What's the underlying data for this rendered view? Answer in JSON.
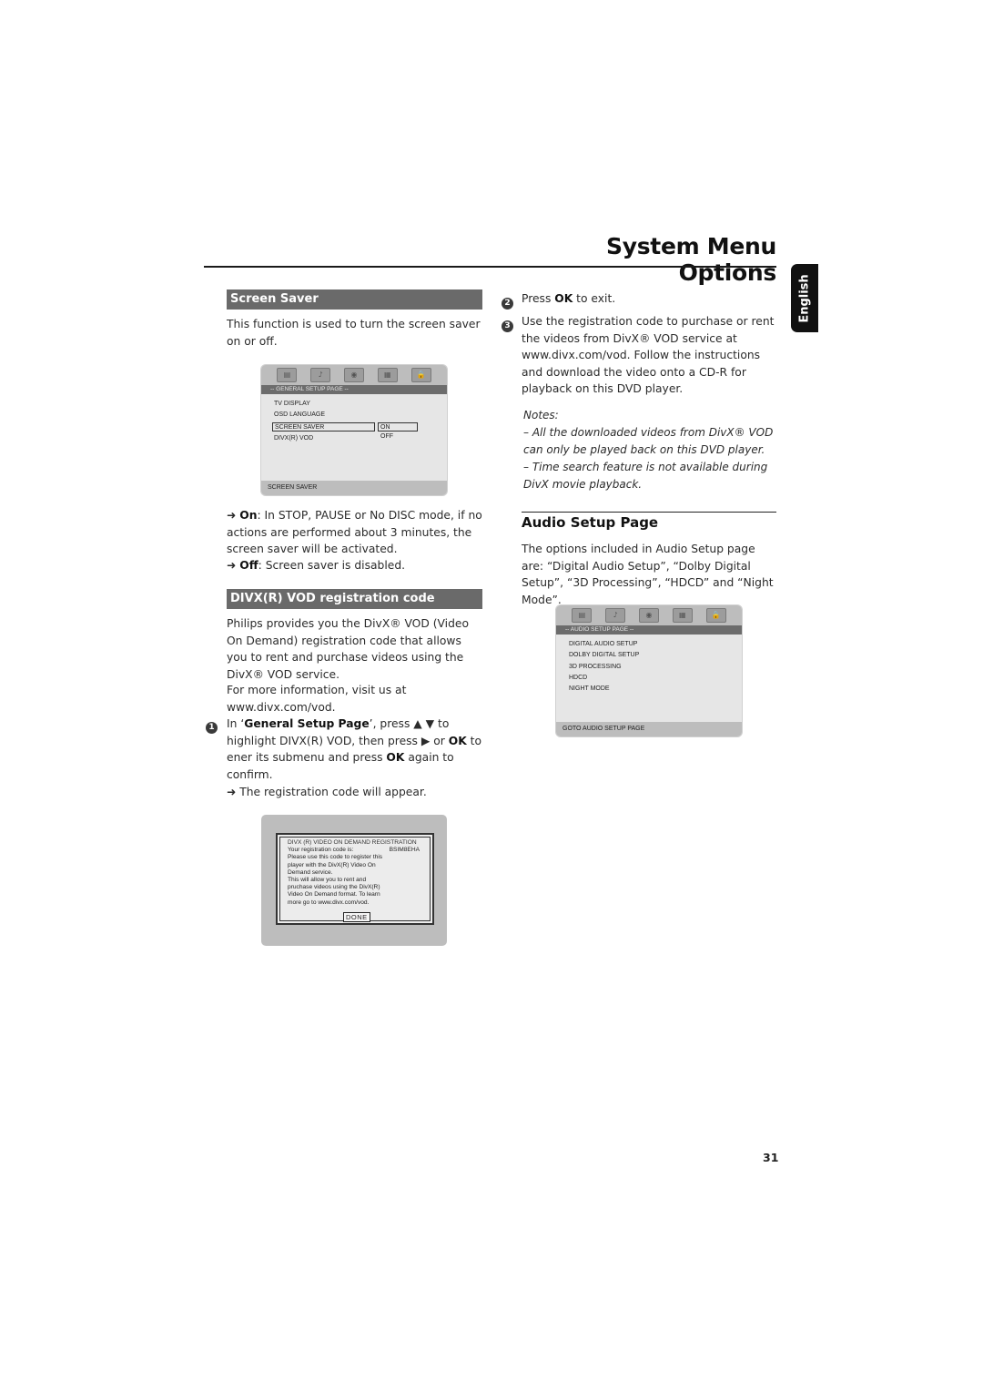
{
  "header": {
    "title": "System Menu Options",
    "language_tab": "English"
  },
  "left_column": {
    "screen_saver": {
      "heading": "Screen Saver",
      "description": "This function is used to turn the screen saver on or off.",
      "osd": {
        "icons": [
          "general-setup-icon",
          "audio-setup-icon",
          "video-setup-icon",
          "preference-icon",
          "password-lock-icon"
        ],
        "page_bar": "-- GENERAL SETUP PAGE --",
        "items": [
          "TV DISPLAY",
          "OSD LANGUAGE",
          "SCREEN SAVER",
          "DIVX(R) VOD"
        ],
        "selected_item": "SCREEN SAVER",
        "options": [
          "ON",
          "OFF"
        ],
        "selected_option": "ON",
        "footer": "SCREEN SAVER"
      },
      "on_label": "On",
      "on_text": ": In STOP, PAUSE or No DISC mode, if no actions are performed about 3 minutes, the screen saver will be activated.",
      "off_label": "Off",
      "off_text": ": Screen saver is disabled."
    },
    "divx": {
      "heading": "DIVX(R) VOD registration code",
      "intro_1": "Philips provides you the DivX® VOD (Video On Demand) registration code that allows you to rent and purchase videos using the DivX® VOD service.",
      "intro_2": "For more information, visit us at www.divx.com/vod.",
      "step1_num": "1",
      "step1_pre": "In ‘",
      "step1_bold": "General Setup Page",
      "step1_mid": "’, press ▲ ▼ to highlight DIVX(R) VOD, then press ▶ or ",
      "step1_ok1": "OK",
      "step1_mid2": " to ener its submenu and press ",
      "step1_ok2": "OK",
      "step1_end": " again to confirm.",
      "step1_result": "The registration code will appear.",
      "dialog": {
        "title": "DIVX (R) VIDEO ON DEMAND REGISTRATION",
        "code_label": "Your registration code is:",
        "code_value": "BSIM8EHA",
        "lines": [
          "Please use this code to register this",
          "player with the DivX(R) Video On",
          "Demand service.",
          "This will allow you to rent and",
          "pruchase videos using the DivX(R)",
          "Video On Demand format. To learn",
          "more go to www.divx.com/vod."
        ],
        "done_button": "DONE"
      }
    }
  },
  "right_column": {
    "step2_num": "2",
    "step2_pre": "Press ",
    "step2_bold": "OK",
    "step2_end": " to exit.",
    "step3_num": "3",
    "step3_text": "Use the registration code to purchase or rent the videos from DivX® VOD service at www.divx.com/vod. Follow the instructions and download the video onto a CD-R for playback on this DVD player.",
    "notes_label": "Notes:",
    "notes": [
      "–   All the downloaded videos from DivX® VOD can only be played back on this DVD player.",
      "–   Time search feature is not available during DivX movie playback."
    ],
    "audio_setup": {
      "heading": "Audio Setup Page",
      "description": "The options included in Audio Setup page are: “Digital Audio Setup”, “Dolby Digital Setup”, “3D Processing”, “HDCD” and “Night Mode”.",
      "osd": {
        "page_bar": "-- AUDIO SETUP PAGE --",
        "items": [
          "DIGITAL AUDIO SETUP",
          "DOLBY DIGITAL SETUP",
          "3D PROCESSING",
          "HDCD",
          "NIGHT MODE"
        ],
        "footer": "GOTO AUDIO SETUP PAGE"
      }
    }
  },
  "footer": {
    "page_number": "31"
  }
}
